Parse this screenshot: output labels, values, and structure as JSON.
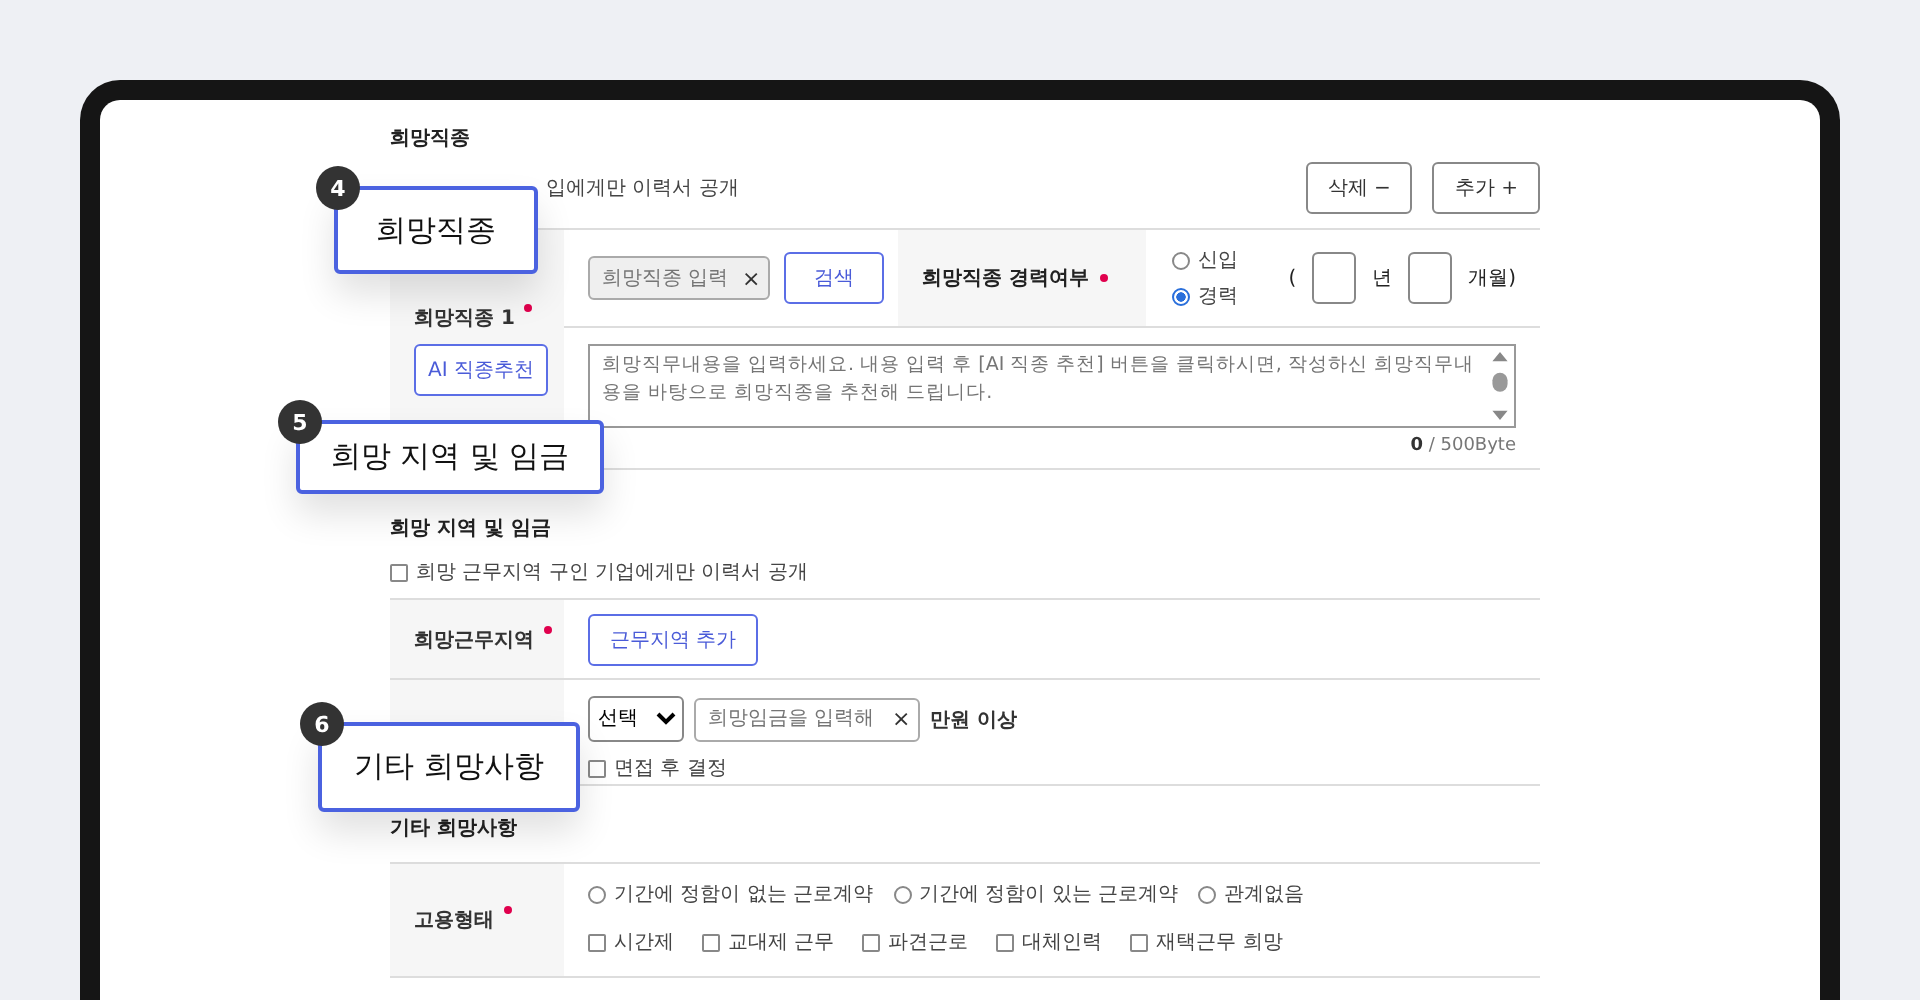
{
  "job_section": {
    "title": "희망직종",
    "public_note": "입에게만 이력서 공개",
    "buttons": [
      {
        "label": "삭제 −"
      },
      {
        "label": "추가 +"
      }
    ],
    "row": {
      "label": "희망직종 1",
      "required": true,
      "ai_button": "AI 직종추천",
      "job_input": {
        "placeholder": "희망직종 입력",
        "clear_icon": "×"
      },
      "search_button": "검색",
      "career_label": "희망직종 경력여부",
      "career_required": true,
      "career_options": [
        {
          "label": "신입",
          "selected": false
        },
        {
          "label": "경력",
          "selected": true
        }
      ],
      "open_paren": "(",
      "years_unit": "년",
      "months_unit": "개월)",
      "description": {
        "placeholder": "희망직무내용을 입력하세요. 내용 입력 후 [AI 직종 추천] 버튼을 클릭하시면, 작성하신 희망직무내용을 바탕으로 희망직종을 추천해 드립니다.",
        "counter": "**0** / 500Byte"
      }
    }
  },
  "region_section": {
    "title": "희망 지역 및 임금",
    "public_checkbox": {
      "label": "희망 근무지역 구인 기업에게만 이력서 공개",
      "checked": false
    },
    "rows": [
      {
        "kind": "region",
        "label": "희망근무지역",
        "required": true,
        "button": "근무지역 추가"
      },
      {
        "kind": "salary",
        "select": "선택",
        "placeholder": "희망임금을 입력해",
        "clear_icon": "×",
        "unit": "만원 이상",
        "negotiable": {
          "label": "면접 후 결정",
          "checked": false
        }
      }
    ]
  },
  "other_section": {
    "title": "기타 희망사항",
    "row": {
      "label": "고용형태",
      "required": true,
      "radios": [
        {
          "label": "기간에 정함이 없는 근로계약",
          "selected": false
        },
        {
          "label": "기간에 정함이 있는 근로계약",
          "selected": false
        },
        {
          "label": "관계없음",
          "selected": false
        }
      ],
      "checkboxes": [
        {
          "label": "시간제",
          "checked": false
        },
        {
          "label": "교대제 근무",
          "checked": false
        },
        {
          "label": "파견근로",
          "checked": false
        },
        {
          "label": "대체인력",
          "checked": false
        },
        {
          "label": "재택근무 희망",
          "checked": false
        }
      ]
    }
  },
  "callouts": [
    {
      "number": "4",
      "label": "희망직종"
    },
    {
      "number": "5",
      "label": "희망 지역 및 임금"
    },
    {
      "number": "6",
      "label": "기타 희망사항"
    }
  ]
}
